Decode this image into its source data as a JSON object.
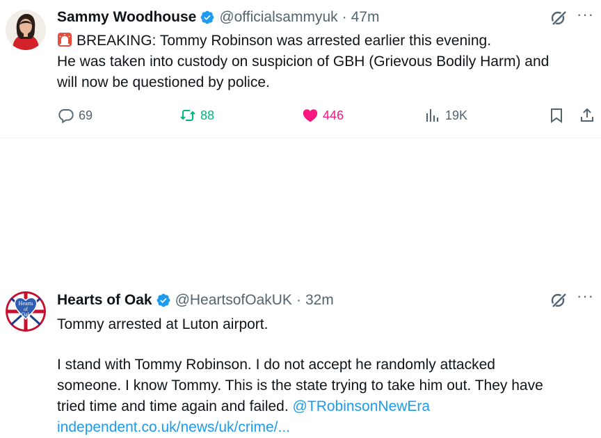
{
  "tweets": [
    {
      "author_name": "Sammy Woodhouse",
      "handle": "@officialsammyuk",
      "separator": "·",
      "time": "47m",
      "lines": [
        "BREAKING: Tommy Robinson was arrested earlier this evening.",
        "He was taken into custody on suspicion of GBH (Grievous Bodily Harm) and",
        "will now be questioned by police."
      ],
      "leading_icon": "siren-icon",
      "stats": {
        "replies": "69",
        "retweets": "88",
        "likes": "446",
        "views": "19K"
      }
    },
    {
      "author_name": "Hearts of Oak",
      "handle": "@HeartsofOakUK",
      "separator": "·",
      "time": "32m",
      "avatar_text": [
        "Hearts",
        "of",
        "Oak"
      ],
      "lines": [
        "Tommy arrested at Luton airport.",
        "",
        "I stand with Tommy Robinson. I do not accept he randomly attacked",
        "someone. I know Tommy. This is the state trying to take him out. They have",
        "tried time and time again and failed."
      ],
      "mention": "@TRobinsonNewEra",
      "link": "independent.co.uk/news/uk/crime/..."
    }
  ],
  "more_label": "···",
  "colors": {
    "accent": "#1d9bf0",
    "retweet": "#00ba7c",
    "like": "#f91880",
    "secondary": "#536471"
  }
}
